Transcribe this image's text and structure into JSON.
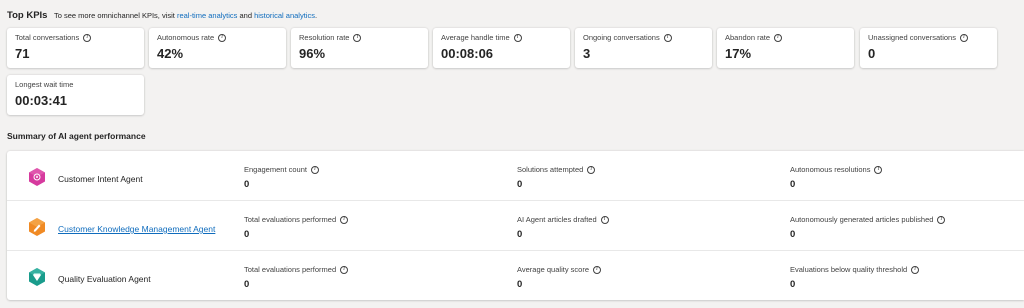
{
  "header": {
    "title": "Top KPIs",
    "subtitle_prefix": "To see more omnichannel KPIs, visit ",
    "link_realtime": "real-time analytics",
    "and_text": " and ",
    "link_historical": "historical analytics",
    "suffix": "."
  },
  "kpis": [
    {
      "label": "Total conversations",
      "value": "71"
    },
    {
      "label": "Autonomous rate",
      "value": "42%"
    },
    {
      "label": "Resolution rate",
      "value": "96%"
    },
    {
      "label": "Average handle time",
      "value": "00:08:06"
    },
    {
      "label": "Ongoing conversations",
      "value": "3"
    },
    {
      "label": "Abandon rate",
      "value": "17%"
    },
    {
      "label": "Unassigned conversations",
      "value": "0"
    },
    {
      "label": "Longest wait time",
      "value": "00:03:41"
    }
  ],
  "summary": {
    "title": "Summary of AI agent performance",
    "agents": [
      {
        "name": "Customer Intent Agent",
        "icon": "customer-intent-agent-icon",
        "metrics": [
          {
            "label": "Engagement count",
            "value": "0"
          },
          {
            "label": "Solutions attempted",
            "value": "0"
          },
          {
            "label": "Autonomous resolutions",
            "value": "0"
          }
        ]
      },
      {
        "name": "Customer Knowledge Management Agent",
        "icon": "knowledge-management-agent-icon",
        "metrics": [
          {
            "label": "Total evaluations performed",
            "value": "0"
          },
          {
            "label": "AI Agent articles drafted",
            "value": "0"
          },
          {
            "label": "Autonomously generated articles published",
            "value": "0"
          }
        ]
      },
      {
        "name": "Quality Evaluation Agent",
        "icon": "quality-evaluation-agent-icon",
        "metrics": [
          {
            "label": "Total evaluations performed",
            "value": "0"
          },
          {
            "label": "Average quality score",
            "value": "0"
          },
          {
            "label": "Evaluations below quality threshold",
            "value": "0"
          }
        ]
      }
    ]
  },
  "colors": {
    "link": "#0f6cbd",
    "intent_agent": "#d63a9e",
    "knowledge_agent": "#f08a24",
    "quality_agent": "#1a9c8c"
  }
}
